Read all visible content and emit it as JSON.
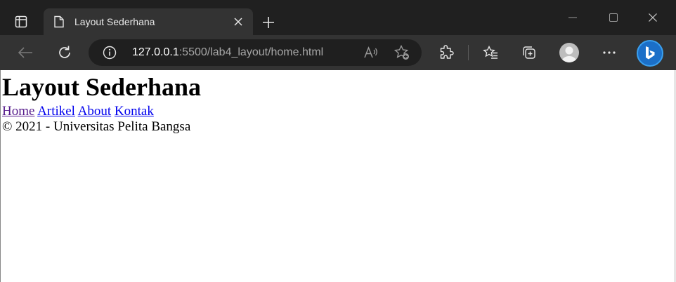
{
  "browser": {
    "tab": {
      "title": "Layout Sederhana",
      "icon": "document-icon"
    },
    "address": {
      "host": "127.0.0.1",
      "rest": ":5500/lab4_layout/home.html"
    },
    "colors": {
      "frame": "#202020",
      "toolbar": "#333333",
      "omnibox": "#1f1f1f",
      "bing": "#1b6fc8"
    }
  },
  "page": {
    "heading": "Layout Sederhana",
    "nav": [
      {
        "label": "Home",
        "visited": true
      },
      {
        "label": "Artikel",
        "visited": false
      },
      {
        "label": "About",
        "visited": false
      },
      {
        "label": "Kontak",
        "visited": false
      }
    ],
    "footer": "© 2021 - Universitas Pelita Bangsa"
  }
}
